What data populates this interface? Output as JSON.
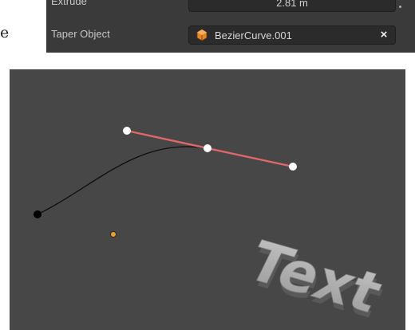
{
  "fragment_text": "e",
  "properties": {
    "extrude": {
      "label": "Extrude",
      "value": "2.81 m"
    },
    "taper_object": {
      "label": "Taper Object",
      "value": "BezierCurve.001",
      "icon": "object-data-icon",
      "clear_label": "×"
    }
  },
  "viewport": {
    "text_object_label": "Text",
    "colors": {
      "background": "#474747",
      "handle_line": "#e06868",
      "control_point": "#ffffff",
      "curve_start_point": "#000000",
      "origin": "#f0a030"
    }
  }
}
